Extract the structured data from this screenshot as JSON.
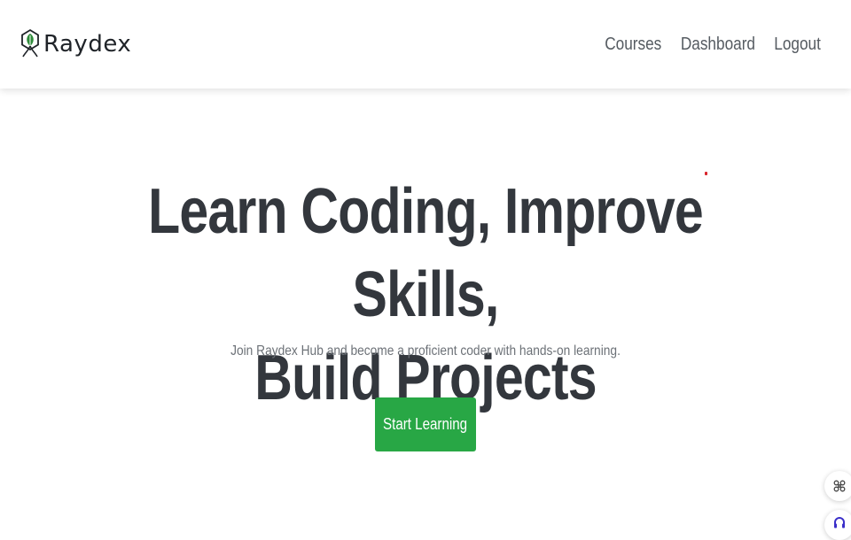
{
  "navbar": {
    "brand_name": "Raydex",
    "brand_icon": "leaf-logo-icon",
    "links": [
      {
        "label": "Courses"
      },
      {
        "label": "Dashboard"
      },
      {
        "label": "Logout"
      }
    ]
  },
  "hero": {
    "title_line_1": "Learn Coding, Improve Skills,",
    "title_line_2": "Build Projects",
    "subtitle": "Join Raydex Hub and become a proficient coder with hands-on learning.",
    "cta_label": "Start Learning"
  },
  "widgets": {
    "shortcut_icon": "command-icon",
    "support_icon": "headset-icon"
  },
  "colors": {
    "accent": "#28a745",
    "title": "#33373d",
    "nav_text": "#555b61",
    "subtitle": "#6c7177",
    "logo_green": "#2e8b3a",
    "logo_dark": "#1f2328"
  }
}
